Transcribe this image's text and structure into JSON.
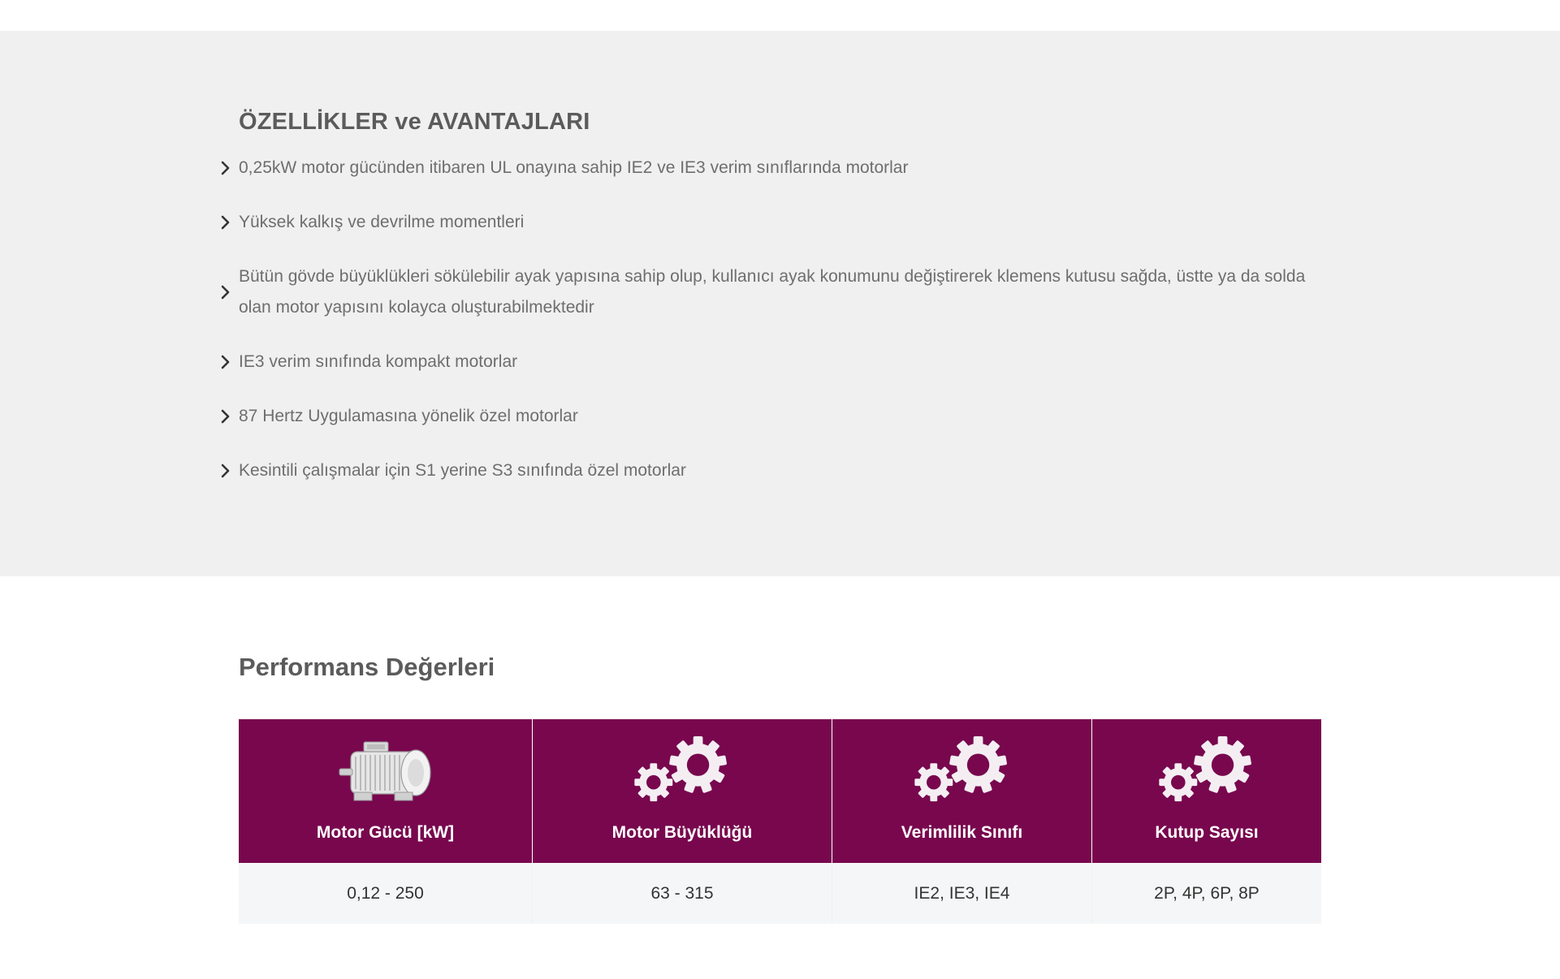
{
  "features": {
    "title": "ÖZELLİKLER ve AVANTAJLARI",
    "items": [
      "0,25kW motor gücünden itibaren UL onayına sahip IE2 ve IE3 verim sınıflarında motorlar",
      "Yüksek kalkış ve devrilme momentleri",
      "Bütün gövde büyüklükleri sökülebilir ayak yapısına sahip olup, kullanıcı ayak konumunu değiştirerek klemens kutusu sağda, üstte ya da solda olan motor yapısını kolayca oluşturabilmektedir",
      "IE3 verim sınıfında kompakt motorlar",
      "87 Hertz Uygulamasına yönelik özel motorlar",
      "Kesintili çalışmalar için S1 yerine S3 sınıfında özel motorlar"
    ]
  },
  "performance": {
    "title": "Performans Değerleri",
    "columns": [
      {
        "label": "Motor Gücü [kW]",
        "icon": "electric-motor-icon",
        "value": "0,12 - 250"
      },
      {
        "label": "Motor Büyüklüğü",
        "icon": "gears-icon",
        "value": "63 - 315"
      },
      {
        "label": "Verimlilik Sınıfı",
        "icon": "gears-icon",
        "value": "IE2, IE3, IE4"
      },
      {
        "label": "Kutup Sayısı",
        "icon": "gears-icon",
        "value": "2P, 4P, 6P, 8P"
      }
    ]
  },
  "colors": {
    "header_bg": "#78074e",
    "section_bg": "#f0f0f0",
    "row_bg": "#f5f6f7"
  }
}
